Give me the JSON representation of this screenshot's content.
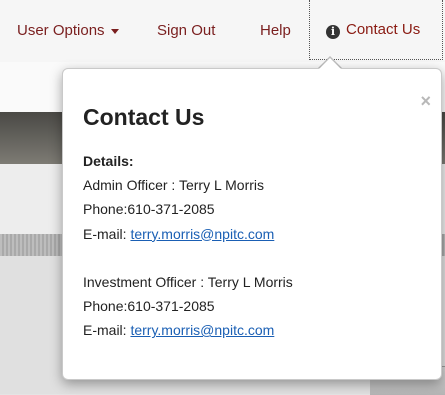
{
  "nav": {
    "user_options": "User Options",
    "sign_out": "Sign Out",
    "help": "Help",
    "contact_us": "Contact Us",
    "contact_icon": "info-icon"
  },
  "popover": {
    "title": "Contact Us",
    "close_symbol": "×",
    "details_label": "Details:",
    "admin": {
      "officer": "Admin Officer : Terry L Morris",
      "phone": "Phone:610-371-2085",
      "email_label": "E-mail: ",
      "email": "terry.morris@npitc.com"
    },
    "investment": {
      "officer": "Investment Officer : Terry L Morris",
      "phone": "Phone:610-371-2085",
      "email_label": "E-mail: ",
      "email": "terry.morris@npitc.com"
    }
  },
  "colors": {
    "nav_text": "#7a1f1f",
    "link": "#1a5fb4",
    "header_dark": "#4a4945"
  }
}
